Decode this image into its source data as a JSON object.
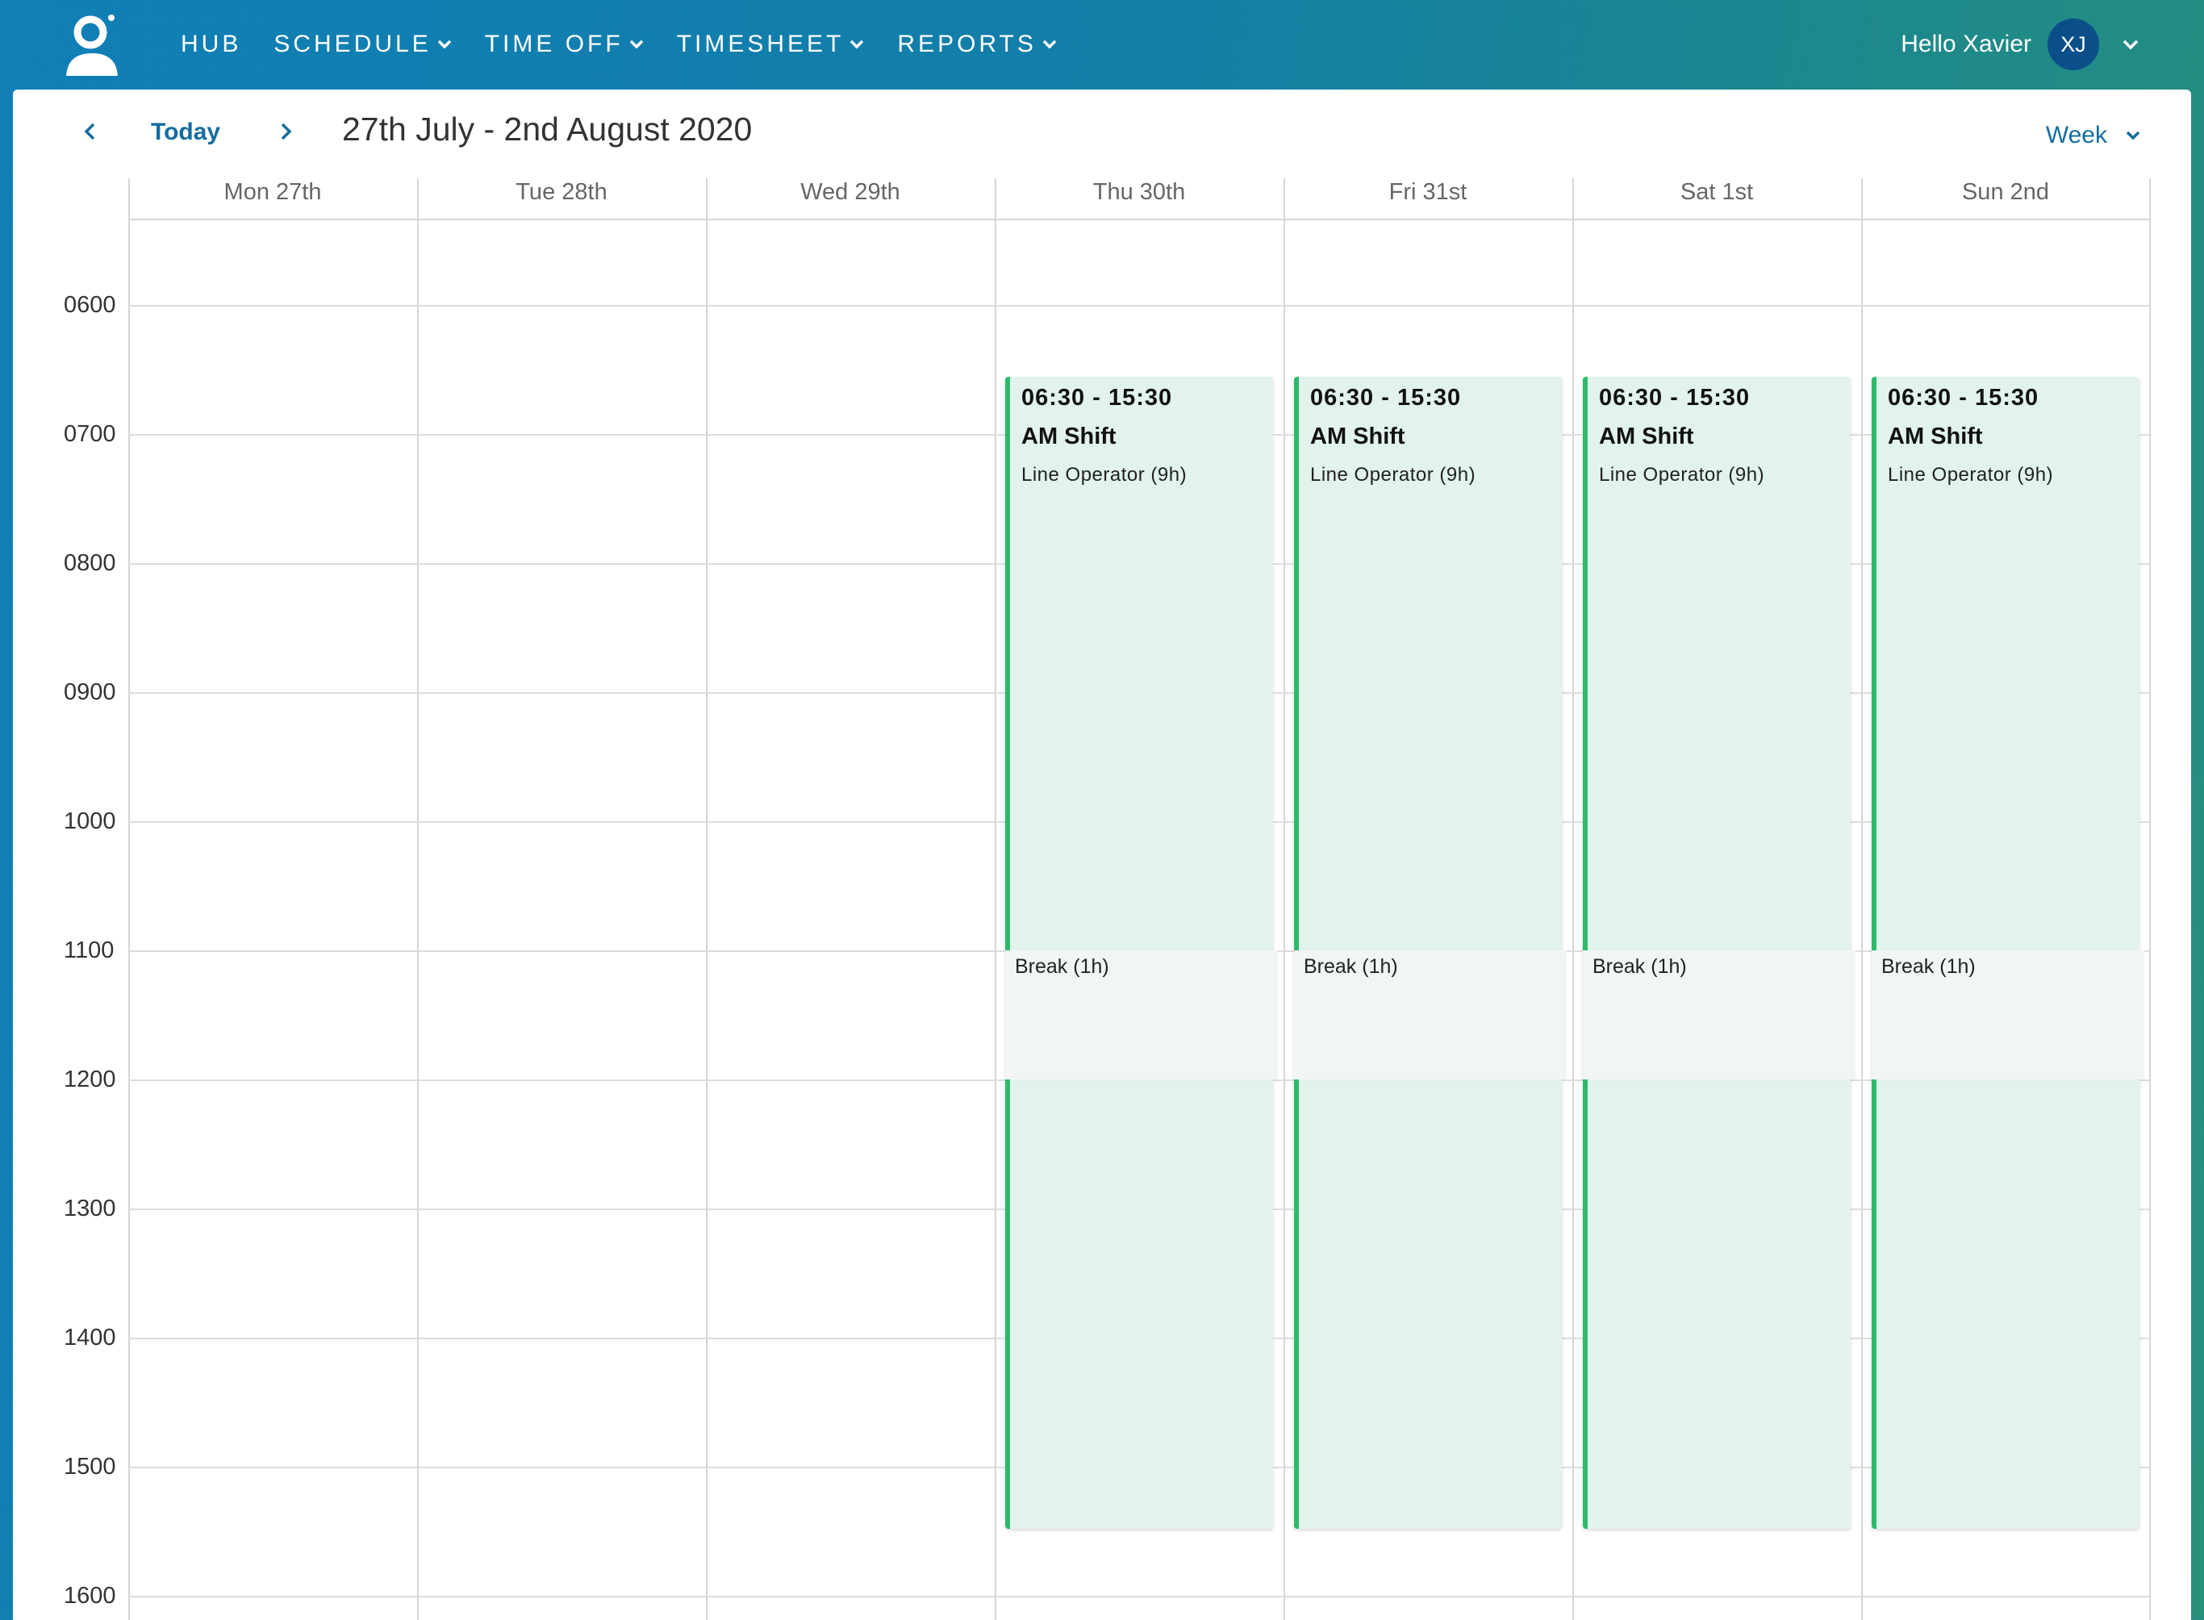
{
  "nav": {
    "items": [
      {
        "label": "HUB",
        "dropdown": false
      },
      {
        "label": "SCHEDULE",
        "dropdown": true
      },
      {
        "label": "TIME OFF",
        "dropdown": true
      },
      {
        "label": "TIMESHEET",
        "dropdown": true
      },
      {
        "label": "REPORTS",
        "dropdown": true
      }
    ],
    "greeting": "Hello Xavier",
    "avatar_initials": "XJ"
  },
  "toolbar": {
    "today_label": "Today",
    "range_title": "27th July - 2nd August 2020",
    "view_label": "Week"
  },
  "calendar": {
    "days": [
      "Mon 27th",
      "Tue 28th",
      "Wed 29th",
      "Thu 30th",
      "Fri 31st",
      "Sat 1st",
      "Sun 2nd"
    ],
    "hours": [
      "0600",
      "0700",
      "0800",
      "0900",
      "1000",
      "1100",
      "1200",
      "1300",
      "1400",
      "1500",
      "1600"
    ],
    "shifts": [
      {
        "day": "Thu 30th",
        "time": "06:30 - 15:30",
        "name": "AM Shift",
        "role": "Line Operator (9h)",
        "break": "Break (1h)"
      },
      {
        "day": "Fri 31st",
        "time": "06:30 - 15:30",
        "name": "AM Shift",
        "role": "Line Operator (9h)",
        "break": "Break (1h)"
      },
      {
        "day": "Sat 1st",
        "time": "06:30 - 15:30",
        "name": "AM Shift",
        "role": "Line Operator (9h)",
        "break": "Break (1h)"
      },
      {
        "day": "Sun 2nd",
        "time": "06:30 - 15:30",
        "name": "AM Shift",
        "role": "Line Operator (9h)",
        "break": "Break (1h)"
      }
    ]
  },
  "colors": {
    "accent": "#146d9e",
    "shift_border": "#2dba6a",
    "shift_fill": "#e1f3ea",
    "break_fill": "#f1f6f5"
  }
}
